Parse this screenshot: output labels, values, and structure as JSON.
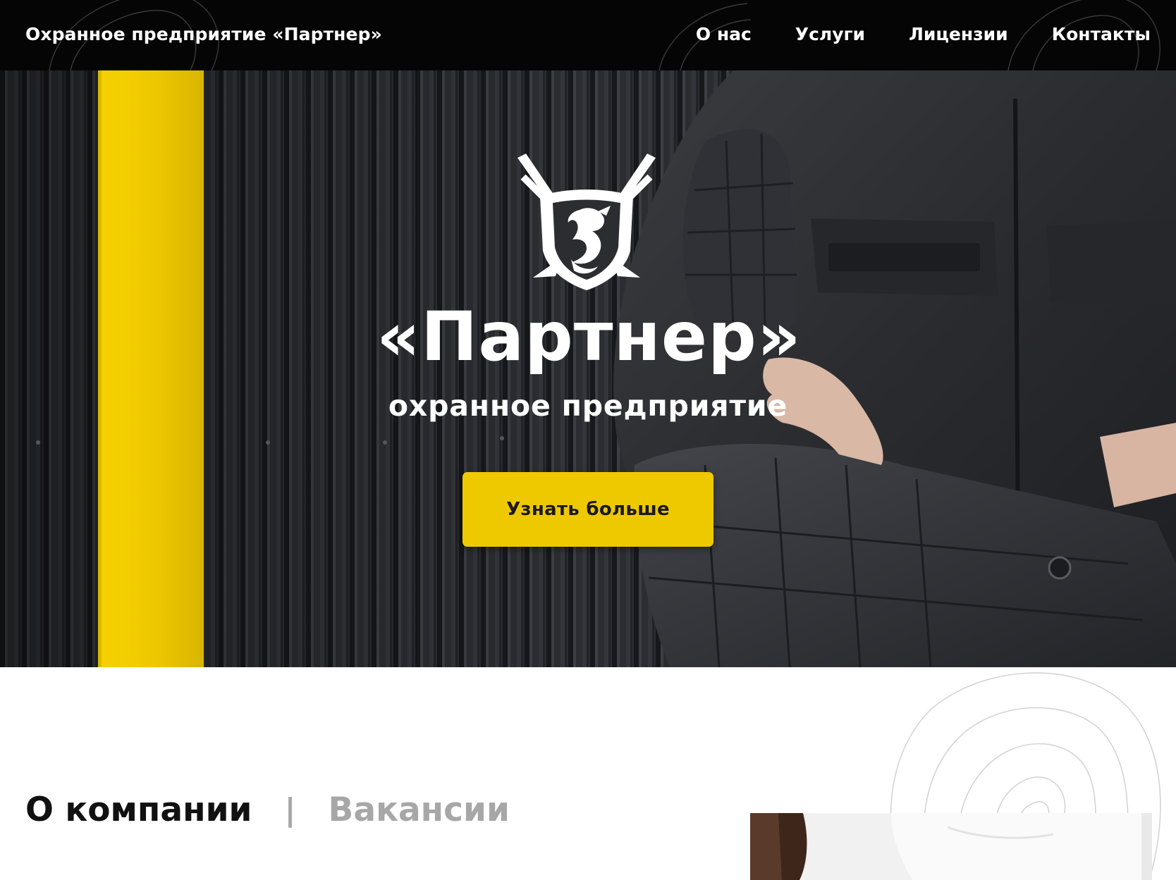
{
  "header": {
    "brand": "Охранное предприятие «Партнер»",
    "nav": [
      {
        "label": "О нас"
      },
      {
        "label": "Услуги"
      },
      {
        "label": "Лицензии"
      },
      {
        "label": "Контакты"
      }
    ]
  },
  "hero": {
    "logo_icon": "shield-dragon-crossed-swords-icon",
    "title": "«Партнер»",
    "subtitle": "охранное предприятие",
    "cta_label": "Узнать больше"
  },
  "sections": {
    "tabs": [
      {
        "label": "О компании",
        "active": true
      },
      {
        "label": "Вакансии",
        "active": false
      }
    ],
    "separator": "|"
  },
  "colors": {
    "accent_yellow": "#efc900",
    "header_bg": "#050505",
    "inactive_tab": "#a7a7a7"
  }
}
